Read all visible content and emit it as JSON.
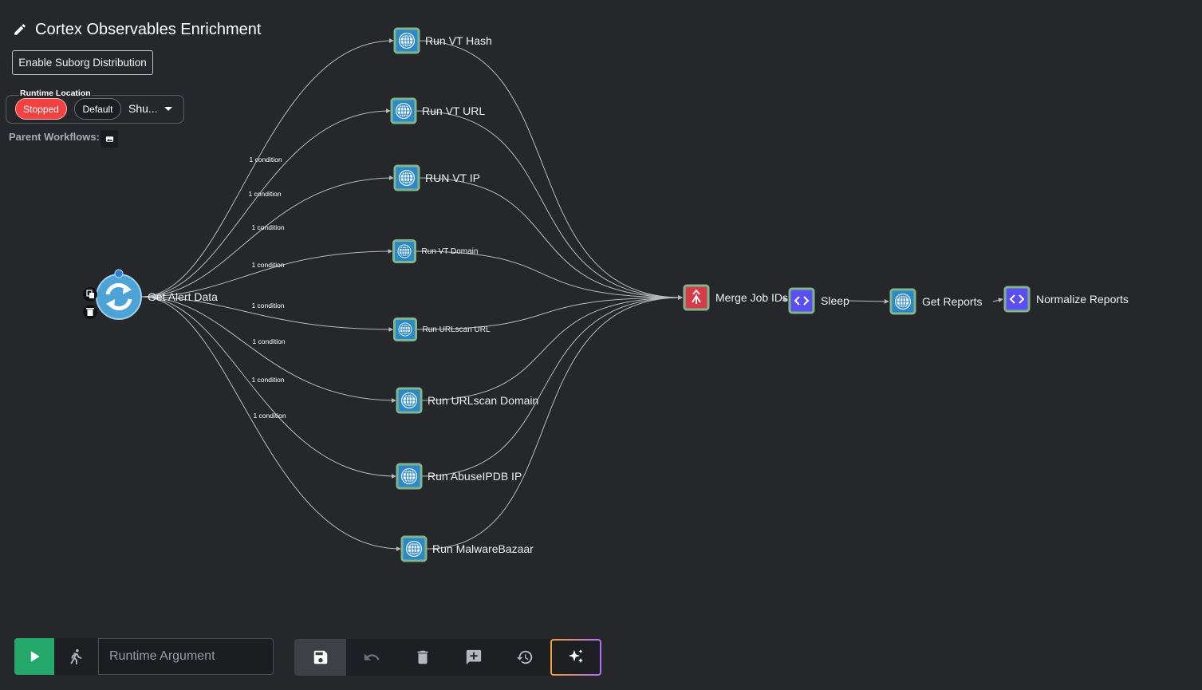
{
  "workflow": {
    "title": "Cortex Observables Enrichment",
    "suborg_button": "Enable Suborg Distribution",
    "runtime_location": {
      "label": "Runtime Location",
      "status": "Stopped",
      "default_chip": "Default",
      "selected_environment": "Shu..."
    },
    "parent_workflows_label": "Parent Workflows:"
  },
  "graph": {
    "start_node": {
      "label": "Get Alert Data",
      "icon": "refresh-cycle-icon"
    },
    "branches": [
      {
        "label": "Run VT Hash",
        "condition": ""
      },
      {
        "label": "Run VT URL",
        "condition": "1 condition"
      },
      {
        "label": "RUN VT IP",
        "condition": "1 condition"
      },
      {
        "label": "Run VT Domain",
        "condition": "1 condition"
      },
      {
        "label": "Run URLscan URL",
        "condition": "1 condition"
      },
      {
        "label": "Run URLscan Domain",
        "condition": "1 condition"
      },
      {
        "label": "Run AbuseIPDB IP",
        "condition": "1 condition"
      },
      {
        "label": "Run MalwareBazaar",
        "condition": "1 condition"
      }
    ],
    "extra_conditions": [
      "1 condition"
    ],
    "chain": [
      {
        "label": "Merge Job IDs",
        "icon": "merge-icon"
      },
      {
        "label": "Sleep",
        "icon": "code-icon"
      },
      {
        "label": "Get Reports",
        "icon": "globe-icon"
      },
      {
        "label": "Normalize Reports",
        "icon": "code-icon"
      }
    ],
    "colors": {
      "background": "#26272b",
      "edge": "#b9babd",
      "node_border": "#7fb58a",
      "globe_bg": "#2c88c8",
      "merge_bg": "#d63b4a",
      "code_bg": "#5a4ff0"
    }
  },
  "toolbar": {
    "runtime_argument_placeholder": "Runtime Argument",
    "buttons": [
      "save",
      "undo",
      "delete",
      "add-comment",
      "history",
      "ai-assist"
    ]
  }
}
